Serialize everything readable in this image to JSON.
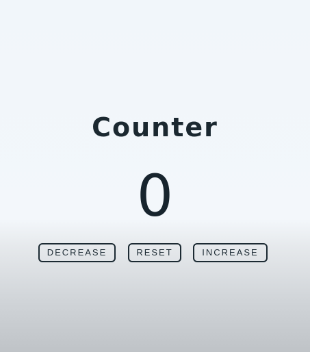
{
  "counter": {
    "title": "Counter",
    "value": "0"
  },
  "buttons": {
    "decrease": "DECREASE",
    "reset": "RESET",
    "increase": "INCREASE"
  },
  "colors": {
    "text": "#1c2a33",
    "background_top": "#f1f6fa",
    "background_bottom": "#bfc3c7"
  }
}
